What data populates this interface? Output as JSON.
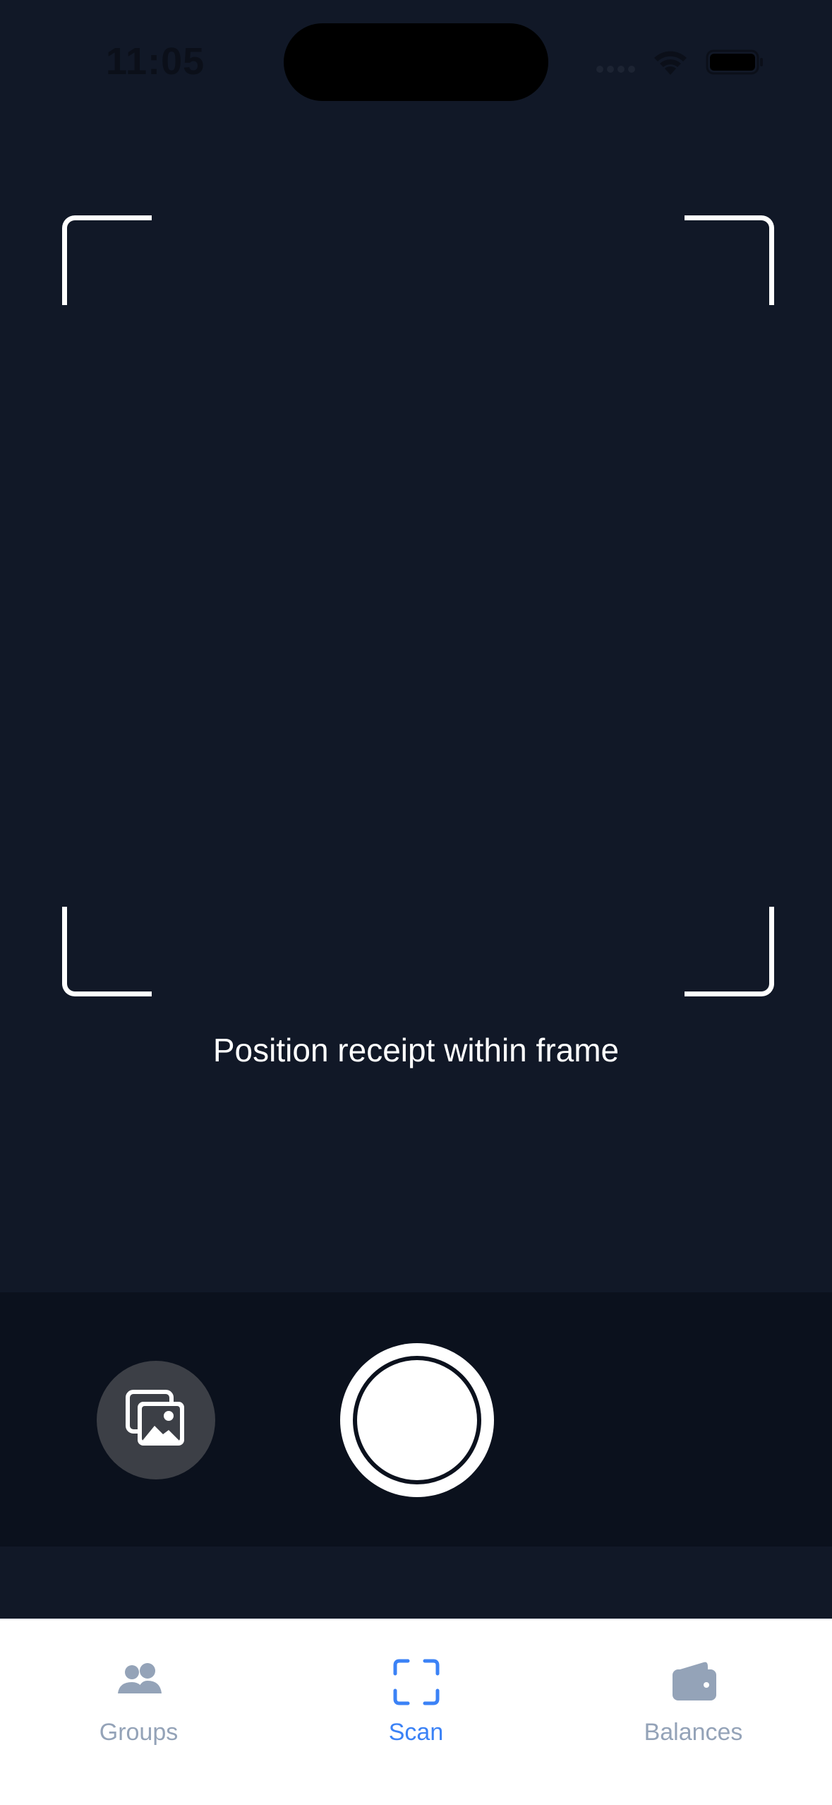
{
  "status_bar": {
    "time": "11:05"
  },
  "scanner": {
    "hint": "Position receipt within frame"
  },
  "tabs": [
    {
      "label": "Groups",
      "icon": "people-icon",
      "active": false
    },
    {
      "label": "Scan",
      "icon": "scan-icon",
      "active": true
    },
    {
      "label": "Balances",
      "icon": "wallet-icon",
      "active": false
    }
  ],
  "colors": {
    "background": "#111827",
    "controls_background": "#0b111d",
    "accent": "#3b82f6",
    "inactive": "#94a3b8",
    "frame": "#ffffff"
  }
}
